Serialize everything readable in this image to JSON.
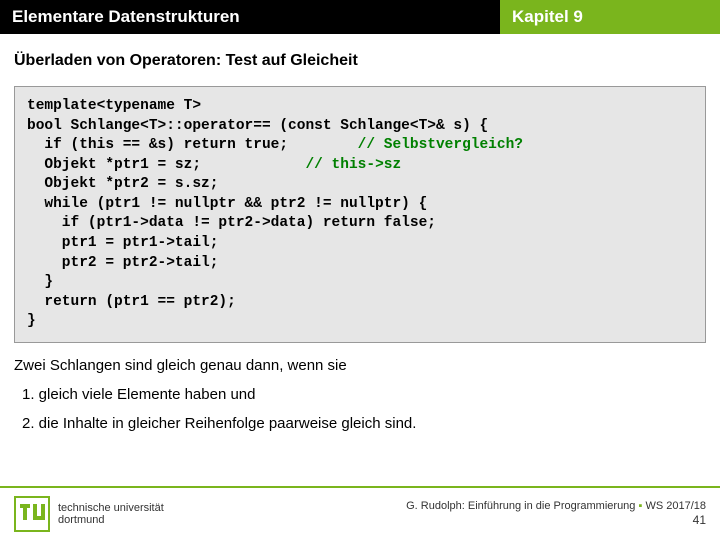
{
  "header": {
    "left": "Elementare Datenstrukturen",
    "right": "Kapitel 9"
  },
  "subtitle": "Überladen von Operatoren: Test auf Gleicheit",
  "code": {
    "l1": "template<typename T>",
    "l2": "bool Schlange<T>::operator== (const Schlange<T>& s) {",
    "l3a": "  if (this == &s) return true;        ",
    "l3c": "// Selbstvergleich?",
    "l4a": "  Objekt *ptr1 = sz;            ",
    "l4c": "// this->sz",
    "l5": "  Objekt *ptr2 = s.sz;",
    "l6": "  while (ptr1 != nullptr && ptr2 != nullptr) {",
    "l7": "    if (ptr1->data != ptr2->data) return false;",
    "l8": "    ptr1 = ptr1->tail;",
    "l9": "    ptr2 = ptr2->tail;",
    "l10": "  }",
    "l11": "  return (ptr1 == ptr2);",
    "l12": "}"
  },
  "paragraph": "Zwei Schlangen sind gleich genau dann, wenn sie",
  "list": {
    "i1": "1.  gleich viele Elemente haben und",
    "i2": "2.  die Inhalte in gleicher Reihenfolge paarweise gleich sind."
  },
  "footer": {
    "uni1": "technische universität",
    "uni2": "dortmund",
    "credit": "G. Rudolph: Einführung in die Programmierung",
    "sep": "▪",
    "term": "WS 2017/18",
    "page": "41"
  }
}
